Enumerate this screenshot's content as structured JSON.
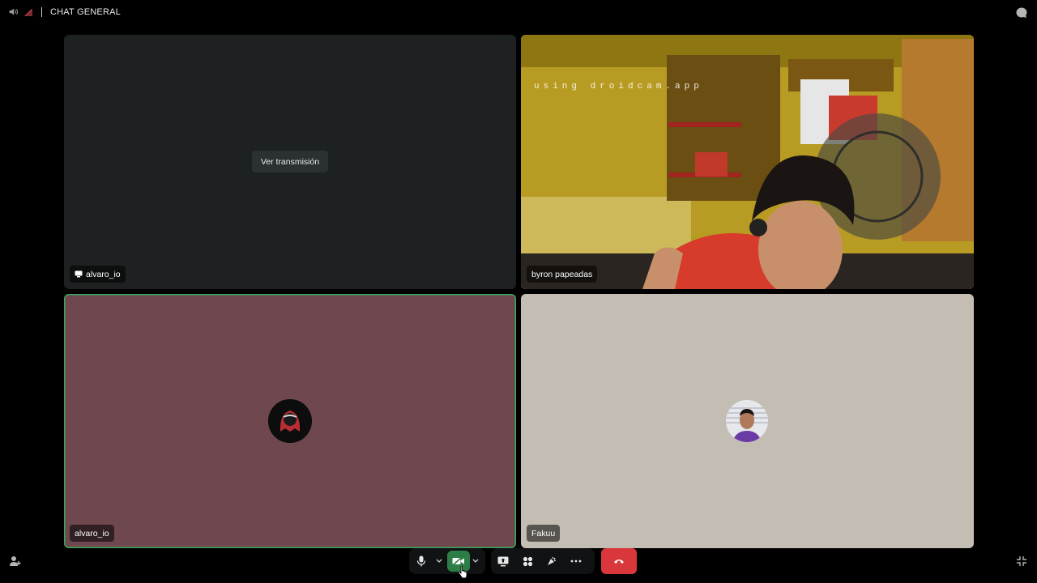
{
  "header": {
    "channel_title": "CHAT GENERAL"
  },
  "tiles": [
    {
      "name": "alvaro_io",
      "stream_button_label": "Ver transmisión",
      "is_streaming": true
    },
    {
      "name": "byron papeadas",
      "overlay_text": "using droidcam.app"
    },
    {
      "name": "alvaro_io",
      "speaking": true
    },
    {
      "name": "Fakuu"
    }
  ],
  "controls": {
    "microphone": "microphone-icon",
    "camera": "camera-icon",
    "screen_share": "screen-share-icon",
    "activities": "activities-icon",
    "soundboard": "soundboard-icon",
    "more": "more-icon",
    "disconnect": "hang-up-icon"
  },
  "colors": {
    "background": "#000000",
    "tile_dark": "#1d2121",
    "tile_maroon": "#6e474f",
    "tile_beige": "#c4bdb3",
    "speaking_outline": "#3ba55c",
    "camera_active": "#2d7d46",
    "end_call": "#da373c"
  }
}
